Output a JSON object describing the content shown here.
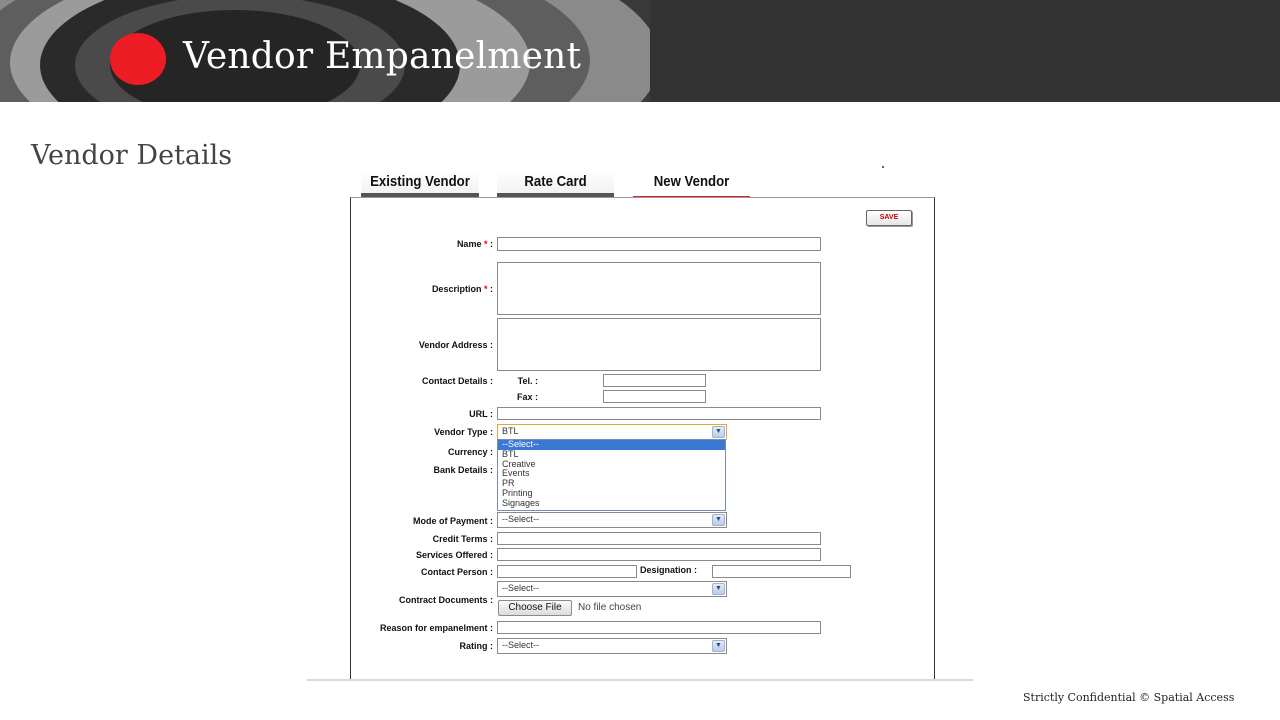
{
  "slide": {
    "title": "Vendor Empanelment",
    "section_title": "Vendor Details",
    "footer": "Strictly Confidential © Spatial Access"
  },
  "tabs": [
    {
      "label": "Existing Vendor",
      "active": false
    },
    {
      "label": "Rate Card",
      "active": false
    },
    {
      "label": "New Vendor",
      "active": true
    }
  ],
  "form": {
    "save_label": "SAVE",
    "name_label": "Name",
    "description_label": "Description",
    "required_mark": "*",
    "colon": ":",
    "vendor_address_label": "Vendor Address :",
    "contact_details_label": "Contact Details :",
    "tel_label": "Tel. :",
    "fax_label": "Fax :",
    "url_label": "URL :",
    "vendor_type_label": "Vendor Type :",
    "vendor_type_value": "BTL",
    "vendor_type_options": [
      "--Select--",
      "BTL",
      "Creative",
      "Events",
      "PR",
      "Printing",
      "Signages"
    ],
    "currency_label": "Currency :",
    "bank_details_label": "Bank Details :",
    "mode_of_payment_label": "Mode of Payment :",
    "mode_of_payment_value": "--Select--",
    "credit_terms_label": "Credit Terms :",
    "services_offered_label": "Services Offered :",
    "contact_person_label": "Contact Person :",
    "designation_label": "Designation :",
    "contract_documents_label": "Contract Documents :",
    "contract_documents_value": "--Select--",
    "choose_file_label": "Choose File",
    "file_status": "No file chosen",
    "reason_label": "Reason for empanelment :",
    "rating_label": "Rating :",
    "rating_value": "--Select--"
  },
  "colors": {
    "accent_red": "#ee1c25",
    "banner_dark": "#333333",
    "highlight_blue": "#3a78d4"
  }
}
